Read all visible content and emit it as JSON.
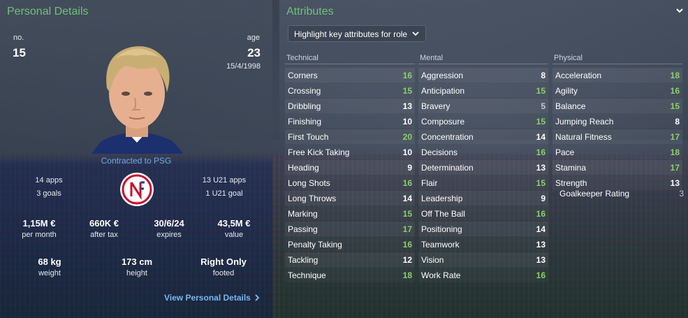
{
  "personal": {
    "title": "Personal Details",
    "no_label": "no.",
    "no_value": "15",
    "age_label": "age",
    "age_value": "23",
    "dob": "15/4/1998",
    "contract": "Contracted to PSG",
    "apps": "14 apps",
    "goals": "3 goals",
    "u21_apps": "13 U21 apps",
    "u21_goals": "1 U21 goal",
    "wage_value": "1,15M €",
    "wage_label": "per month",
    "after_tax_value": "660K €",
    "after_tax_label": "after tax",
    "expires_value": "30/6/24",
    "expires_label": "expires",
    "value_value": "43,5M €",
    "value_label": "value",
    "weight_value": "68 kg",
    "weight_label": "weight",
    "height_value": "173 cm",
    "height_label": "height",
    "footed_value": "Right Only",
    "footed_label": "footed",
    "view_link": "View Personal Details",
    "view_link_icon": "chevron-right-icon",
    "club_logo_text": "NFF"
  },
  "attributes": {
    "title": "Attributes",
    "highlight_dropdown": "Highlight key attributes for role",
    "technical_header": "Technical",
    "mental_header": "Mental",
    "physical_header": "Physical",
    "technical": [
      {
        "name": "Corners",
        "value": "16"
      },
      {
        "name": "Crossing",
        "value": "15"
      },
      {
        "name": "Dribbling",
        "value": "13"
      },
      {
        "name": "Finishing",
        "value": "10"
      },
      {
        "name": "First Touch",
        "value": "20"
      },
      {
        "name": "Free Kick Taking",
        "value": "10"
      },
      {
        "name": "Heading",
        "value": "9"
      },
      {
        "name": "Long Shots",
        "value": "16"
      },
      {
        "name": "Long Throws",
        "value": "14"
      },
      {
        "name": "Marking",
        "value": "15"
      },
      {
        "name": "Passing",
        "value": "17"
      },
      {
        "name": "Penalty Taking",
        "value": "16"
      },
      {
        "name": "Tackling",
        "value": "12"
      },
      {
        "name": "Technique",
        "value": "18"
      }
    ],
    "mental": [
      {
        "name": "Aggression",
        "value": "8"
      },
      {
        "name": "Anticipation",
        "value": "15"
      },
      {
        "name": "Bravery",
        "value": "5"
      },
      {
        "name": "Composure",
        "value": "15"
      },
      {
        "name": "Concentration",
        "value": "14"
      },
      {
        "name": "Decisions",
        "value": "16"
      },
      {
        "name": "Determination",
        "value": "13"
      },
      {
        "name": "Flair",
        "value": "15"
      },
      {
        "name": "Leadership",
        "value": "9"
      },
      {
        "name": "Off The Ball",
        "value": "16"
      },
      {
        "name": "Positioning",
        "value": "14"
      },
      {
        "name": "Teamwork",
        "value": "13"
      },
      {
        "name": "Vision",
        "value": "13"
      },
      {
        "name": "Work Rate",
        "value": "16"
      }
    ],
    "physical": [
      {
        "name": "Acceleration",
        "value": "18"
      },
      {
        "name": "Agility",
        "value": "16"
      },
      {
        "name": "Balance",
        "value": "15"
      },
      {
        "name": "Jumping Reach",
        "value": "8"
      },
      {
        "name": "Natural Fitness",
        "value": "17"
      },
      {
        "name": "Pace",
        "value": "18"
      },
      {
        "name": "Stamina",
        "value": "17"
      },
      {
        "name": "Strength",
        "value": "13"
      }
    ],
    "goalkeeper_label": "Goalkeeper Rating",
    "goalkeeper_value": "3"
  },
  "colors": {
    "accent_green": "#6fc17a",
    "high_value": "#8bd06a",
    "link_blue": "#7ab4f0"
  }
}
